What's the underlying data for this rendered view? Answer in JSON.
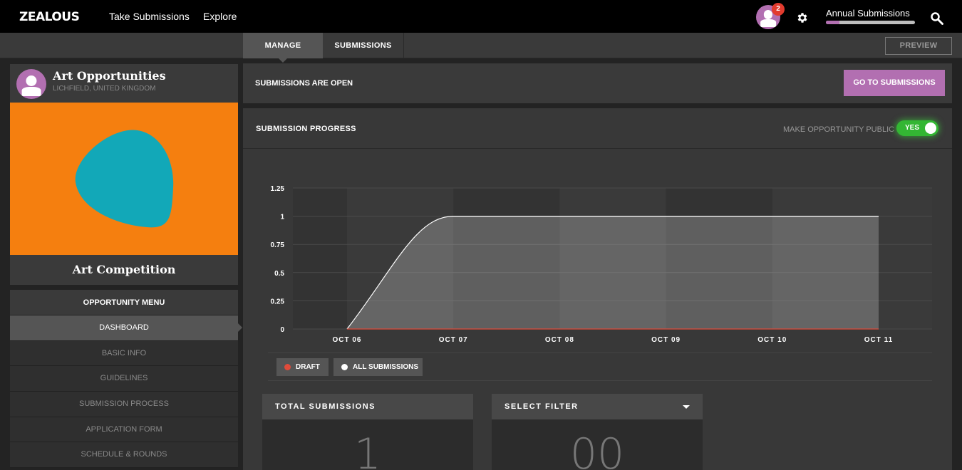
{
  "topbar": {
    "logo": "ZEALOUS",
    "nav": [
      "Take Submissions",
      "Explore"
    ],
    "notification_count": "2",
    "annual_label": "Annual Submissions",
    "annual_progress": 0.15
  },
  "tabs": [
    "MANAGE",
    "SUBMISSIONS"
  ],
  "preview_label": "PREVIEW",
  "org": {
    "title": "Art Opportunities",
    "location": "LICHFIELD, UNITED KINGDOM",
    "caption": "Art Competition"
  },
  "menu": {
    "heading": "OPPORTUNITY MENU",
    "items": [
      "DASHBOARD",
      "BASIC INFO",
      "GUIDELINES",
      "SUBMISSION PROCESS",
      "APPLICATION FORM",
      "SCHEDULE & ROUNDS"
    ]
  },
  "status": {
    "text": "SUBMISSIONS ARE OPEN",
    "button": "GO TO SUBMISSIONS"
  },
  "progress": {
    "title": "SUBMISSION PROGRESS",
    "public_label": "MAKE OPPORTUNITY PUBLIC",
    "toggle_label": "YES"
  },
  "legend": [
    "DRAFT",
    "ALL SUBMISSIONS"
  ],
  "colors": {
    "accent": "#b26fb1",
    "toggle_on": "#33b633",
    "draft": "#e04b3a",
    "all_submissions": "#ffffff",
    "hero_bg": "#f57f0f",
    "hero_shape": "#12a8b8"
  },
  "stats": {
    "total_label": "TOTAL SUBMISSIONS",
    "total_value": "1",
    "filter_label": "SELECT FILTER",
    "filter_value": "00"
  },
  "chart_data": {
    "type": "area",
    "categories": [
      "OCT 06",
      "OCT 07",
      "OCT 08",
      "OCT 09",
      "OCT 10",
      "OCT 11"
    ],
    "yticks": [
      "0",
      "0.25",
      "0.5",
      "0.75",
      "1",
      "1.25"
    ],
    "ylim": [
      0,
      1.25
    ],
    "series": [
      {
        "name": "DRAFT",
        "values": [
          0,
          0,
          0,
          0,
          0,
          0
        ]
      },
      {
        "name": "ALL SUBMISSIONS",
        "values": [
          0,
          1,
          1,
          1,
          1,
          1
        ]
      }
    ]
  }
}
